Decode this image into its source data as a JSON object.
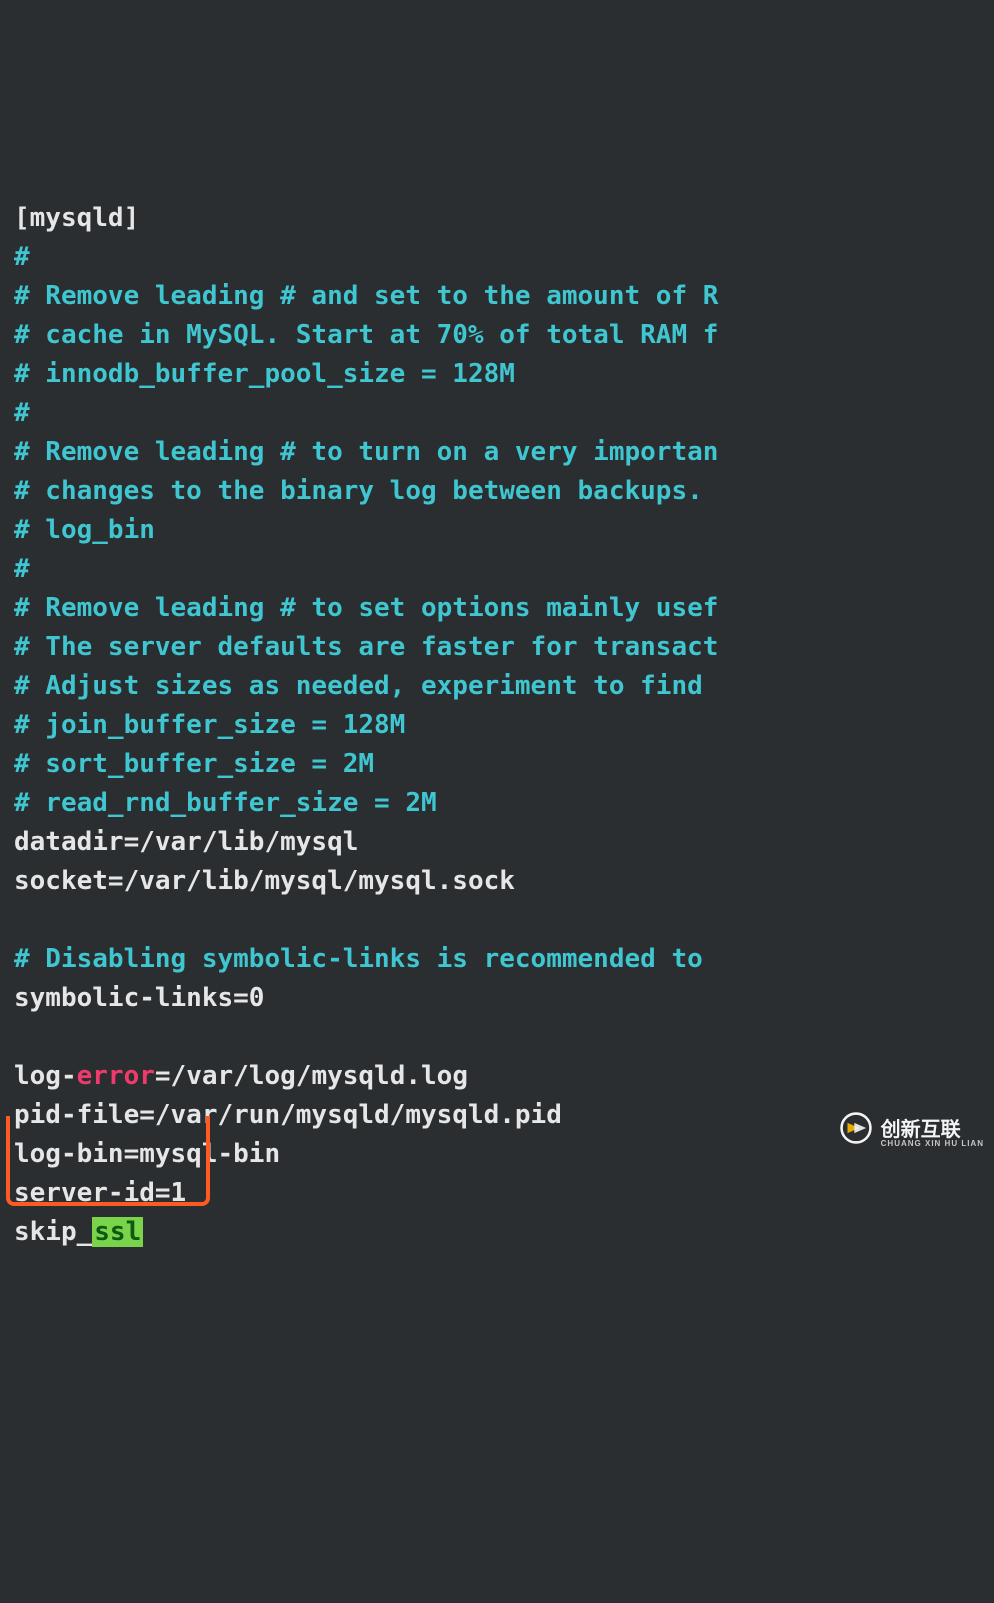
{
  "lines": {
    "l01": "[mysqld]",
    "l02": "#",
    "l03": "# Remove leading # and set to the amount of R",
    "l04": "# cache in MySQL. Start at 70% of total RAM f",
    "l05": "# innodb_buffer_pool_size = 128M",
    "l06": "#",
    "l07": "# Remove leading # to turn on a very importan",
    "l08": "# changes to the binary log between backups.",
    "l09": "# log_bin",
    "l10": "#",
    "l11": "# Remove leading # to set options mainly usef",
    "l12": "# The server defaults are faster for transact",
    "l13": "# Adjust sizes as needed, experiment to find ",
    "l14": "# join_buffer_size = 128M",
    "l15": "# sort_buffer_size = 2M",
    "l16": "# read_rnd_buffer_size = 2M",
    "l17": "datadir=/var/lib/mysql",
    "l18": "socket=/var/lib/mysql/mysql.sock",
    "l19": "",
    "l20": "# Disabling symbolic-links is recommended to ",
    "l21": "symbolic-links=0",
    "l22": "",
    "l23a": "log-",
    "l23b": "error",
    "l23c": "=/var/log/mysqld.log",
    "l24": "pid-file=/var/run/mysqld/mysqld.pid",
    "l25": "log-bin=mysql-bin",
    "l26": "server-id=1",
    "l27a": "skip_",
    "l27b": "ssl"
  },
  "watermark": {
    "cn": "创新互联",
    "en": "CHUANG XIN HU LIAN"
  }
}
